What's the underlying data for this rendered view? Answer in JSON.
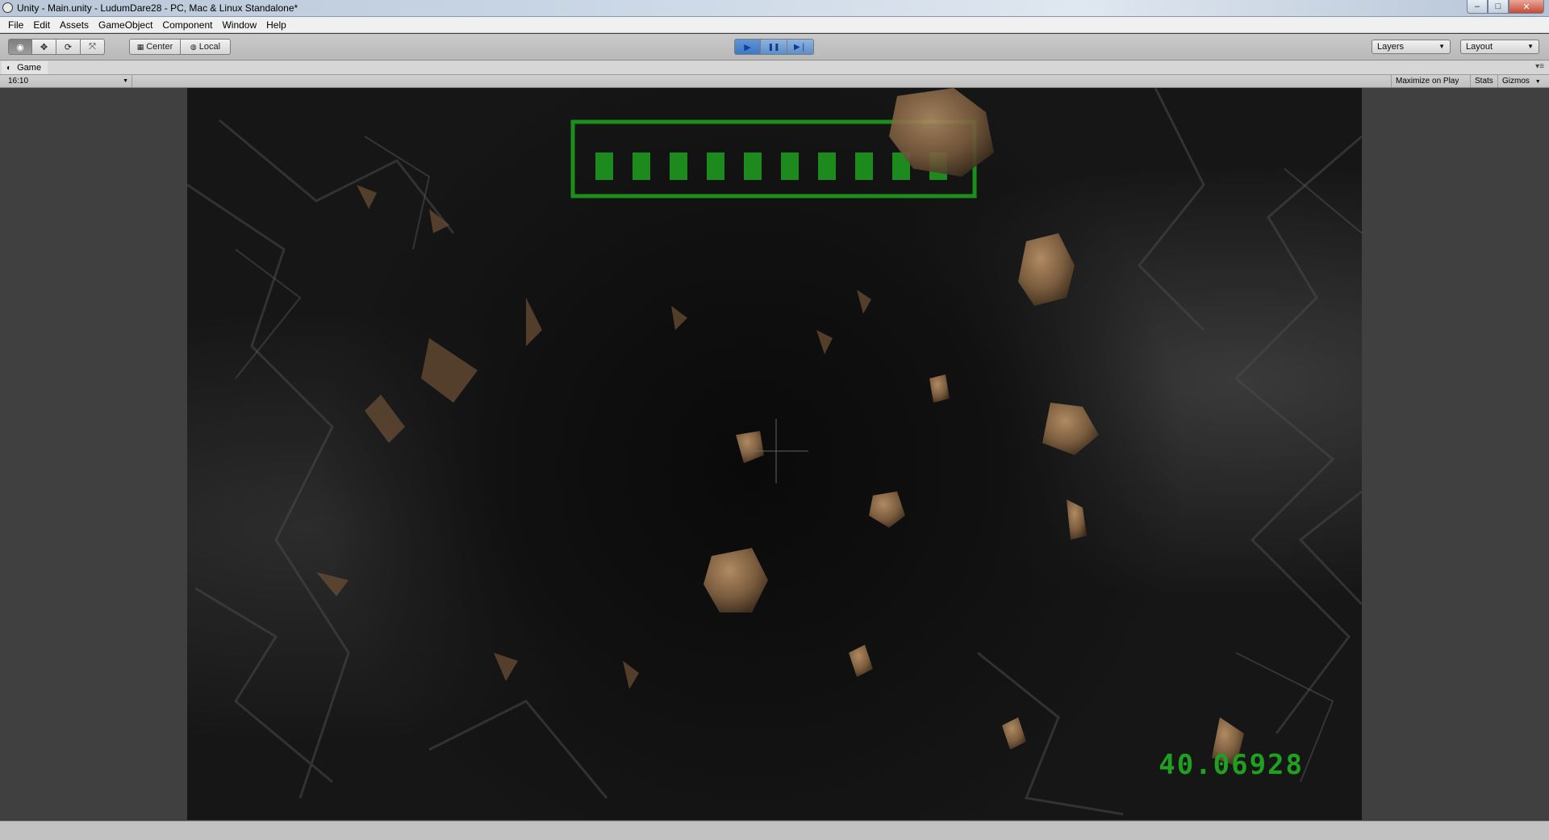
{
  "window": {
    "title": "Unity - Main.unity - LudumDare28 - PC, Mac & Linux Standalone*",
    "controls": {
      "minimize": "–",
      "maximize": "□",
      "close": "✕"
    }
  },
  "menu": [
    "File",
    "Edit",
    "Assets",
    "GameObject",
    "Component",
    "Window",
    "Help"
  ],
  "toolbar": {
    "transform_tools": [
      {
        "name": "view-tool",
        "icon": "eye-icon",
        "glyph": "◉",
        "active": true
      },
      {
        "name": "move-tool",
        "icon": "move-icon",
        "glyph": "✥",
        "active": false
      },
      {
        "name": "rotate-tool",
        "icon": "rotate-icon",
        "glyph": "⟳",
        "active": false
      },
      {
        "name": "scale-tool",
        "icon": "scale-icon",
        "glyph": "⤧",
        "active": false
      }
    ],
    "pivot": {
      "center_label": "Center",
      "local_label": "Local"
    },
    "playback": {
      "play": "▶",
      "pause": "❚❚",
      "step": "▶❘"
    },
    "layers_label": "Layers",
    "layout_label": "Layout"
  },
  "game_tab": {
    "label": "Game",
    "icon": "game-controller-icon"
  },
  "game_toolbar": {
    "aspect": "16:10",
    "maximize_on_play": "Maximize on Play",
    "stats": "Stats",
    "gizmos": "Gizmos"
  },
  "game": {
    "score": "40.06928",
    "health_segments_total": 10,
    "health_segments_filled": 10,
    "colors": {
      "hud_green": "#1fa11f",
      "asteroid": "#8a6a48",
      "play_blue": "#3f78c2"
    }
  }
}
